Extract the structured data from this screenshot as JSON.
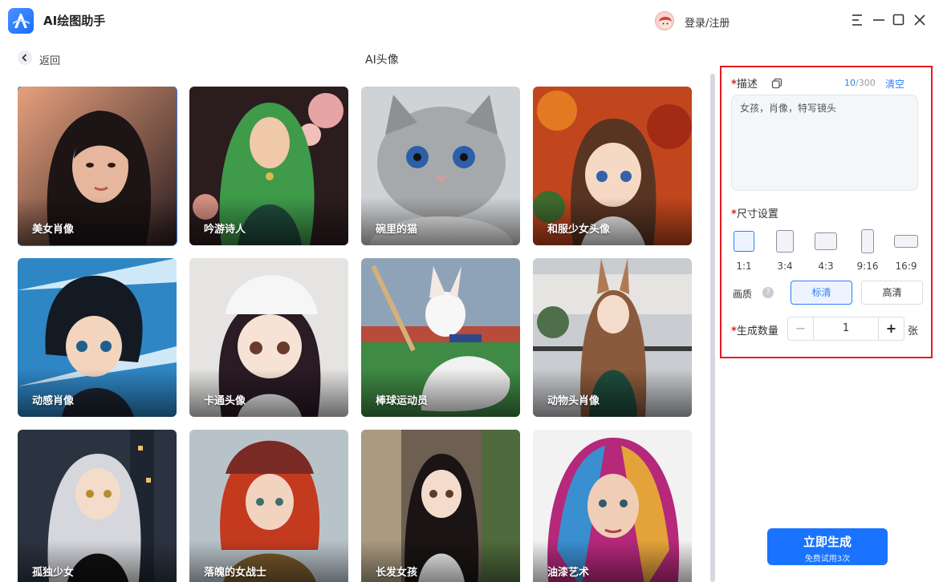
{
  "app": {
    "title": "AI绘图助手"
  },
  "header": {
    "login_label": "登录/注册"
  },
  "subheader": {
    "back_label": "返回",
    "page_title": "AI头像"
  },
  "gallery": {
    "items": [
      {
        "label": "美女肖像"
      },
      {
        "label": "吟游诗人"
      },
      {
        "label": "碗里的猫"
      },
      {
        "label": "和服少女头像"
      },
      {
        "label": "动感肖像"
      },
      {
        "label": "卡通头像"
      },
      {
        "label": "棒球运动员"
      },
      {
        "label": "动物头肖像"
      },
      {
        "label": "孤独少女"
      },
      {
        "label": "落魄的女战士"
      },
      {
        "label": "长发女孩"
      },
      {
        "label": "油漆艺术"
      }
    ]
  },
  "panel": {
    "required_mark": "*",
    "description_label": "描述",
    "counter_current": "10",
    "counter_max": "/300",
    "clear_label": "清空",
    "description_value": "女孩，肖像，特写镜头",
    "size_label": "尺寸设置",
    "ratios": [
      "1:1",
      "3:4",
      "4:3",
      "9:16",
      "16:9"
    ],
    "quality_label": "画质",
    "help_icon": "?",
    "quality_standard": "标清",
    "quality_high": "高清",
    "count_label": "生成数量",
    "count_minus": "−",
    "count_value": "1",
    "count_plus": "+",
    "count_unit": "张"
  },
  "generate": {
    "label": "立即生成",
    "sub_label": "免费试用3次"
  },
  "colors": {
    "accent": "#1a73ff",
    "highlight_border": "#e31b23"
  }
}
